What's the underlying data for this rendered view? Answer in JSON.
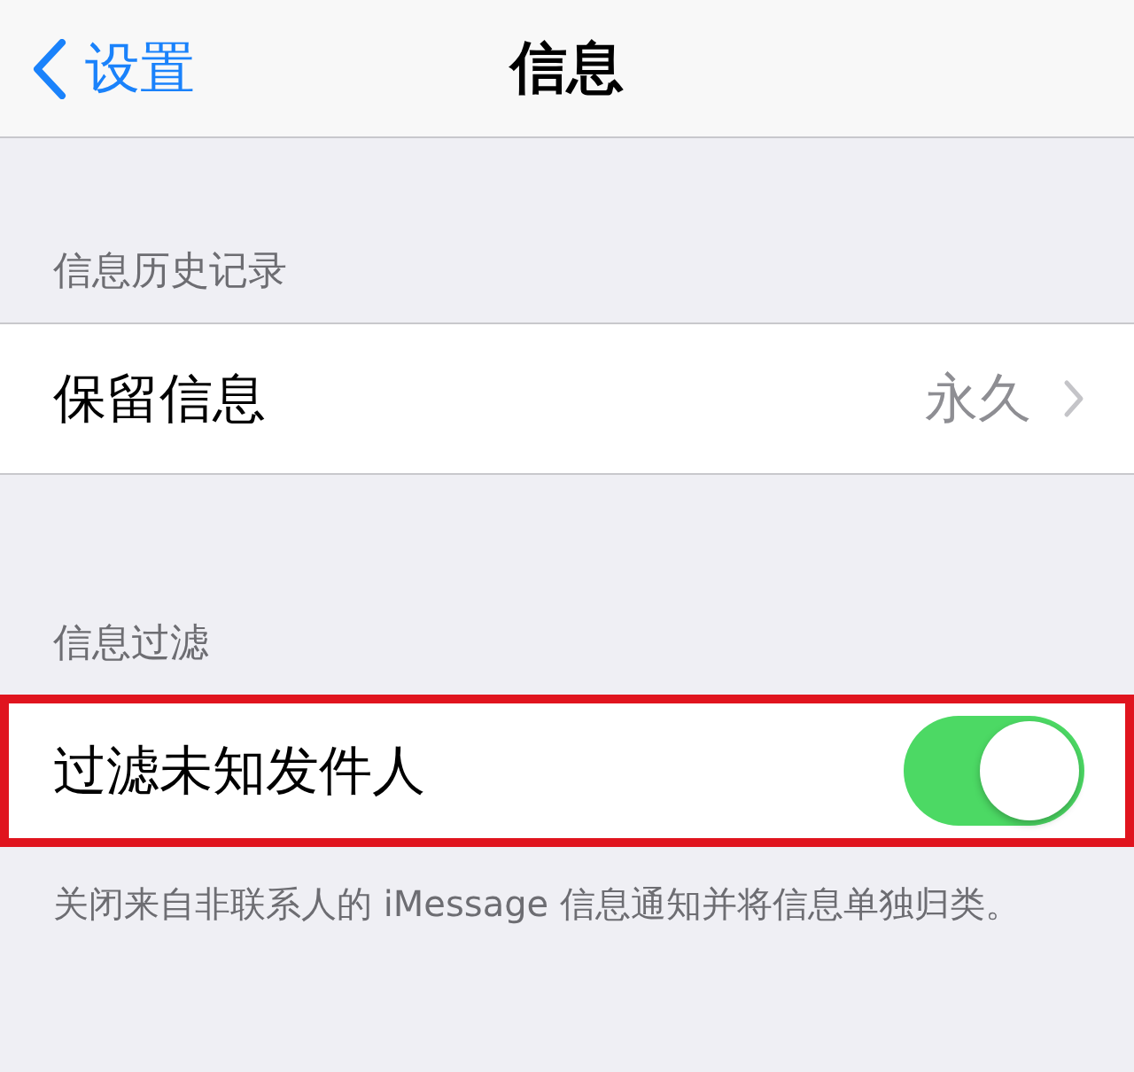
{
  "nav": {
    "back_label": "设置",
    "title": "信息"
  },
  "sections": [
    {
      "header": "信息历史记录",
      "rows": [
        {
          "kind": "detail",
          "label": "保留信息",
          "value": "永久",
          "highlighted": false
        }
      ]
    },
    {
      "header": "信息过滤",
      "rows": [
        {
          "kind": "toggle",
          "label": "过滤未知发件人",
          "on": true,
          "highlighted": true
        }
      ],
      "footer": "关闭来自非联系人的 iMessage 信息通知并将信息单独归类。"
    }
  ]
}
